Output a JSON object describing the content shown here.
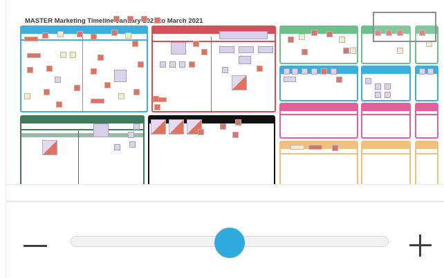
{
  "board": {
    "title": "MASTER Marketing Timeline January 2021 to March 2021"
  },
  "minimap": {
    "frame_colors": {
      "blue": "#3aaedc",
      "red": "#d2505a",
      "green_light": "#6cc08a",
      "green_dark": "#3f7a5e",
      "black": "#111111",
      "pink": "#e0609a",
      "orange": "#f0bf7a"
    },
    "note_color": "#e2725b"
  },
  "zoom": {
    "level": 0.5,
    "zoom_out_icon": "minus-icon",
    "zoom_in_icon": "plus-icon",
    "accent": "#30a9de"
  }
}
